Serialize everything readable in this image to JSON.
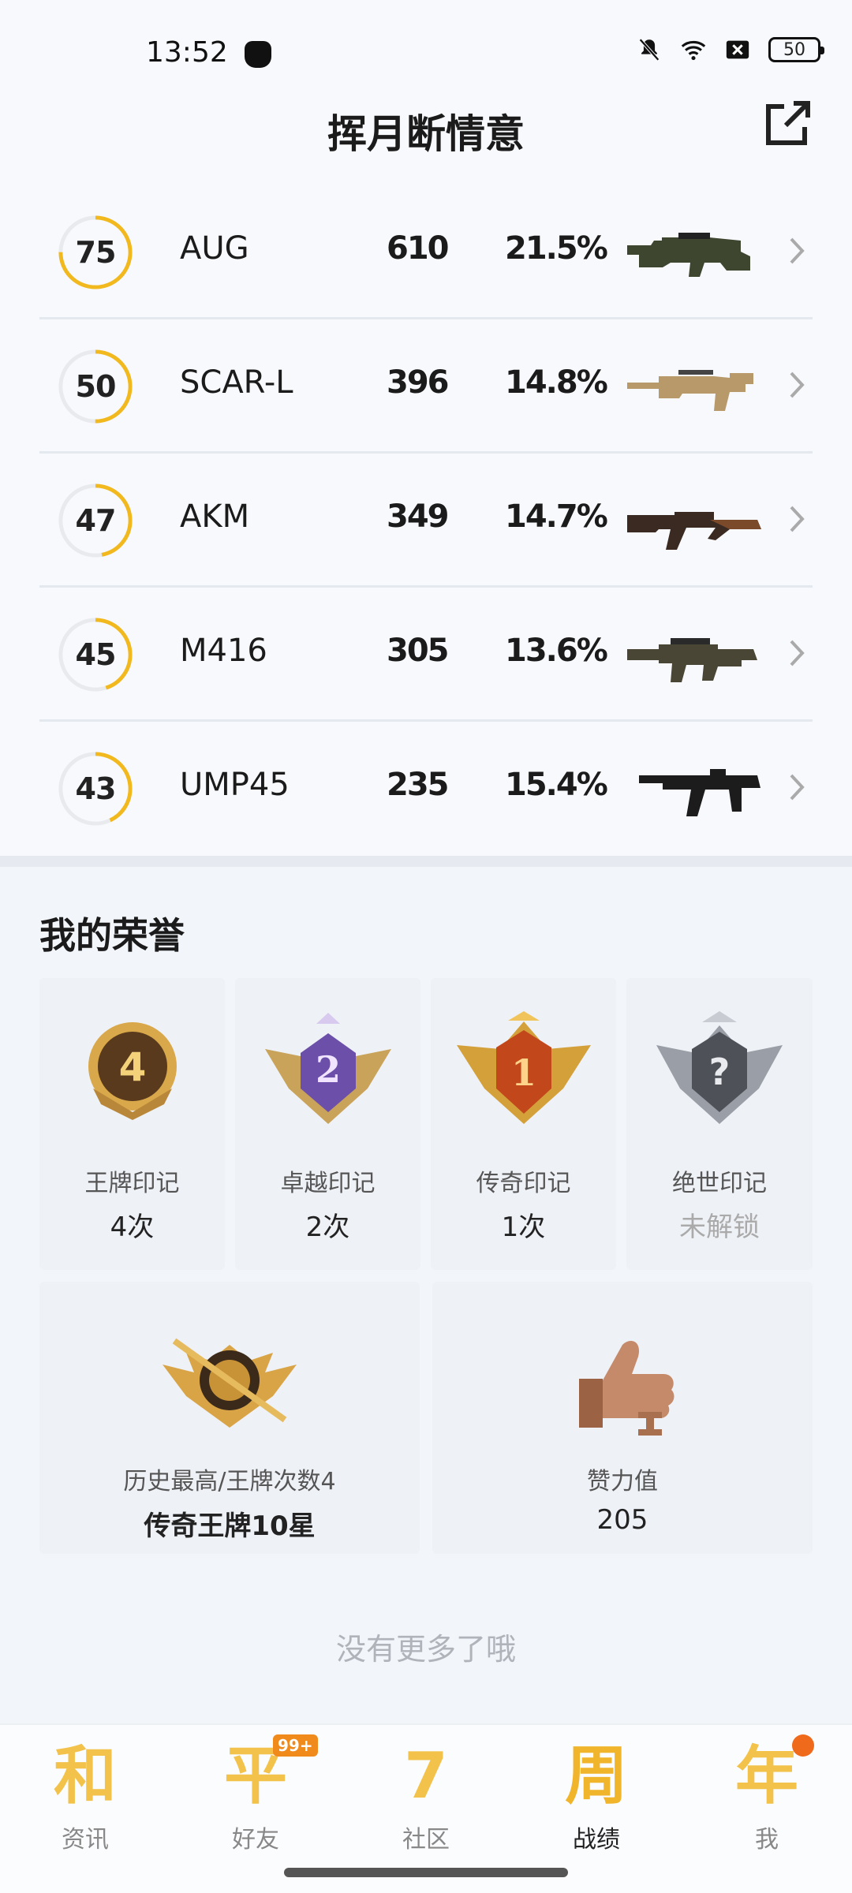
{
  "status_bar": {
    "time": "13:52",
    "battery": "50"
  },
  "header": {
    "title": "挥月断情意"
  },
  "weapons": [
    {
      "level": "75",
      "level_pct": 0.75,
      "name": "AUG",
      "kills": "610",
      "rate": "21.5%"
    },
    {
      "level": "50",
      "level_pct": 0.5,
      "name": "SCAR-L",
      "kills": "396",
      "rate": "14.8%"
    },
    {
      "level": "47",
      "level_pct": 0.47,
      "name": "AKM",
      "kills": "349",
      "rate": "14.7%"
    },
    {
      "level": "45",
      "level_pct": 0.45,
      "name": "M416",
      "kills": "305",
      "rate": "13.6%"
    },
    {
      "level": "43",
      "level_pct": 0.43,
      "name": "UMP45",
      "kills": "235",
      "rate": "15.4%"
    }
  ],
  "honor": {
    "title": "我的荣誉",
    "badges": [
      {
        "label": "王牌印记",
        "value": "4次",
        "icon": "ace-mark-icon",
        "number": "4"
      },
      {
        "label": "卓越印记",
        "value": "2次",
        "icon": "excellence-mark-icon",
        "number": "2"
      },
      {
        "label": "传奇印记",
        "value": "1次",
        "icon": "legend-mark-icon",
        "number": "1"
      },
      {
        "label": "绝世印记",
        "value": "未解锁",
        "icon": "peerless-mark-icon",
        "number": "?"
      }
    ],
    "highest": {
      "label": "历史最高/王牌次数4",
      "value": "传奇王牌10星"
    },
    "likes": {
      "label": "赞力值",
      "value": "205"
    }
  },
  "footer": {
    "no_more": "没有更多了哦"
  },
  "tabs": [
    {
      "label": "资讯",
      "glyph": "和",
      "active": false
    },
    {
      "label": "好友",
      "glyph": "平",
      "badge": "99+",
      "active": false
    },
    {
      "label": "社区",
      "glyph": "7",
      "active": false
    },
    {
      "label": "战绩",
      "glyph": "周",
      "active": true
    },
    {
      "label": "我",
      "glyph": "年",
      "active": false
    }
  ],
  "colors": {
    "accent": "#f2b91e",
    "ring_track": "#e8eaee",
    "tab_gold": "#f2c24a"
  }
}
